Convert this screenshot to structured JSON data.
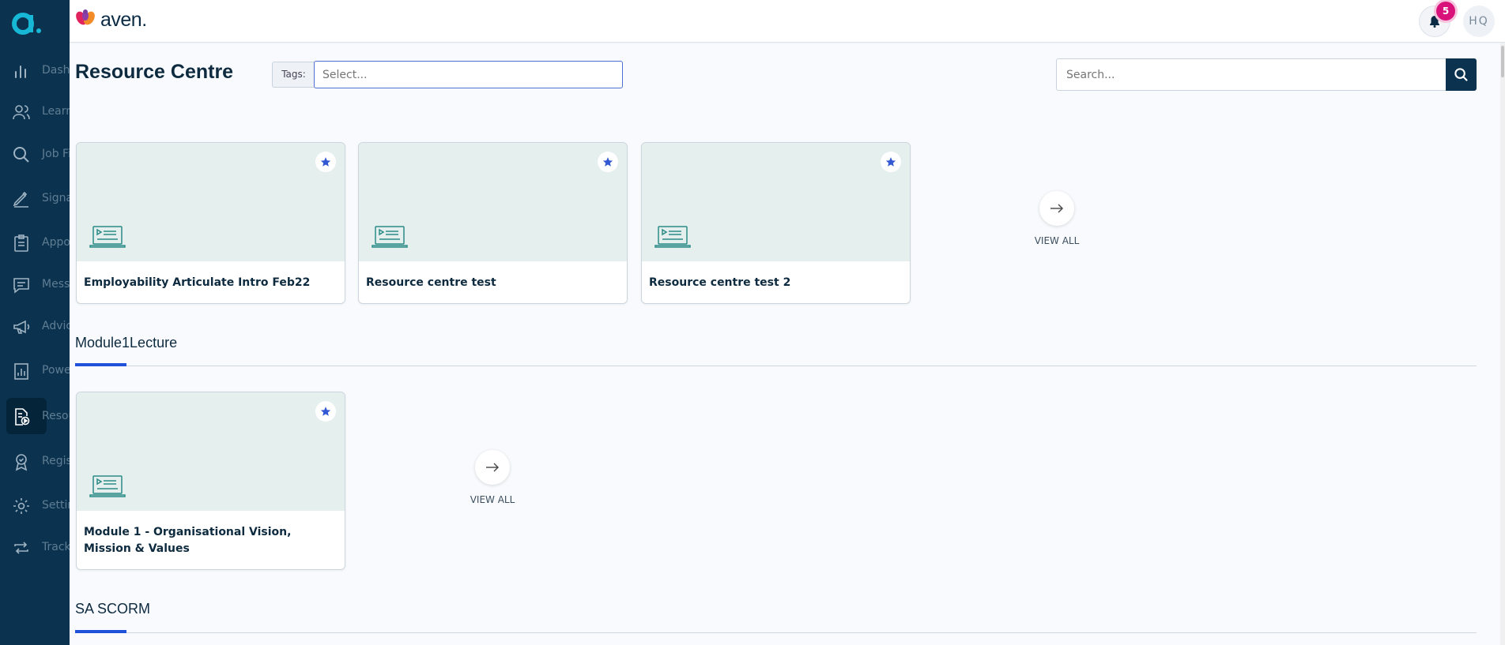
{
  "app": {
    "brand": "aven."
  },
  "sidebar": {
    "items": [
      {
        "label": "Dashboard",
        "icon": "bar-chart-icon"
      },
      {
        "label": "Learners",
        "icon": "users-icon"
      },
      {
        "label": "Job Finder",
        "icon": "search-icon"
      },
      {
        "label": "Signature",
        "icon": "pen-icon"
      },
      {
        "label": "Appointments",
        "icon": "clipboard-icon"
      },
      {
        "label": "Messages",
        "icon": "chat-icon"
      },
      {
        "label": "Advice",
        "icon": "megaphone-icon"
      },
      {
        "label": "Power BI",
        "icon": "report-icon"
      },
      {
        "label": "Resources",
        "icon": "resource-icon"
      },
      {
        "label": "Registrations",
        "icon": "badge-icon"
      },
      {
        "label": "Settings",
        "icon": "gear-icon"
      },
      {
        "label": "Tracking",
        "icon": "repeat-icon"
      }
    ]
  },
  "topbar": {
    "notifications_count": "5",
    "avatar_initials": "HQ"
  },
  "page": {
    "title": "Resource Centre",
    "tags_label": "Tags:",
    "tags_placeholder": "Select...",
    "search_placeholder": "Search..."
  },
  "sections": [
    {
      "title": "",
      "cards": [
        {
          "title": "Employability Articulate Intro Feb22"
        },
        {
          "title": "Resource centre test"
        },
        {
          "title": "Resource centre test 2"
        }
      ],
      "view_all": "VIEW ALL"
    },
    {
      "title": "Module1Lecture",
      "cards": [
        {
          "title": "Module 1 - Organisational Vision, Mission & Values"
        }
      ],
      "view_all": "VIEW ALL"
    },
    {
      "title": "SA SCORM",
      "cards": []
    }
  ],
  "colors": {
    "sidebar": "#0b3350",
    "accent": "#2150d9",
    "badge": "#d8127a",
    "thumb": "#e4efee",
    "icon_teal": "#2b8c86"
  }
}
